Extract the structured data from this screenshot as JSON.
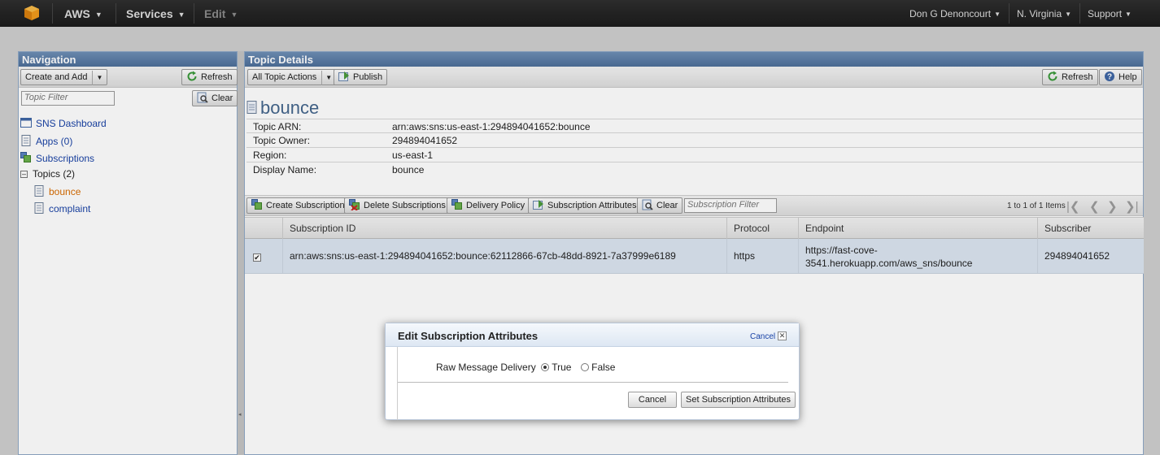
{
  "topbar": {
    "aws_label": "AWS",
    "services_label": "Services",
    "edit_label": "Edit",
    "user_label": "Don G Denoncourt",
    "region_label": "N. Virginia",
    "support_label": "Support"
  },
  "navigation": {
    "title": "Navigation",
    "create_add_label": "Create and Add",
    "refresh_label": "Refresh",
    "filter_placeholder": "Topic Filter",
    "clear_label": "Clear",
    "items": {
      "dashboard": "SNS Dashboard",
      "apps": "Apps (0)",
      "subscriptions": "Subscriptions",
      "topics": "Topics (2)",
      "bounce": "bounce",
      "complaint": "complaint"
    }
  },
  "topic_details": {
    "title": "Topic Details",
    "all_actions_label": "All Topic Actions",
    "publish_label": "Publish",
    "refresh_label": "Refresh",
    "help_label": "Help",
    "topic_name": "bounce",
    "fields": [
      {
        "key": "Topic ARN:",
        "value": "arn:aws:sns:us-east-1:294894041652:bounce"
      },
      {
        "key": "Topic Owner:",
        "value": "294894041652"
      },
      {
        "key": "Region:",
        "value": "us-east-1"
      },
      {
        "key": "Display Name:",
        "value": "bounce"
      }
    ]
  },
  "subscriptions_toolbar": {
    "create_label": "Create Subscription",
    "delete_label": "Delete Subscriptions",
    "delivery_policy_label": "Delivery Policy",
    "attributes_label": "Subscription Attributes",
    "clear_label": "Clear",
    "filter_placeholder": "Subscription Filter",
    "pager_text": "1 to 1 of 1 Items"
  },
  "subscriptions_table": {
    "headers": [
      "Subscription ID",
      "Protocol",
      "Endpoint",
      "Subscriber"
    ],
    "rows": [
      {
        "checked": true,
        "subscription_id": "arn:aws:sns:us-east-1:294894041652:bounce:62112866-67cb-48dd-8921-7a37999e6189",
        "protocol": "https",
        "endpoint_line1": "https://fast-cove-",
        "endpoint_line2": "3541.herokuapp.com/aws_sns/bounce",
        "subscriber": "294894041652"
      }
    ]
  },
  "modal": {
    "title": "Edit Subscription Attributes",
    "header_cancel": "Cancel",
    "field_label": "Raw Message Delivery",
    "option_true": "True",
    "option_false": "False",
    "selected": "True",
    "cancel_label": "Cancel",
    "submit_label": "Set Subscription Attributes"
  },
  "colors": {
    "topbar": "#1f1f1f",
    "panel_header": "#5a7aa5",
    "link": "#1a43a6",
    "active_link": "#d86c00",
    "selected_row": "#dbe5f1"
  }
}
